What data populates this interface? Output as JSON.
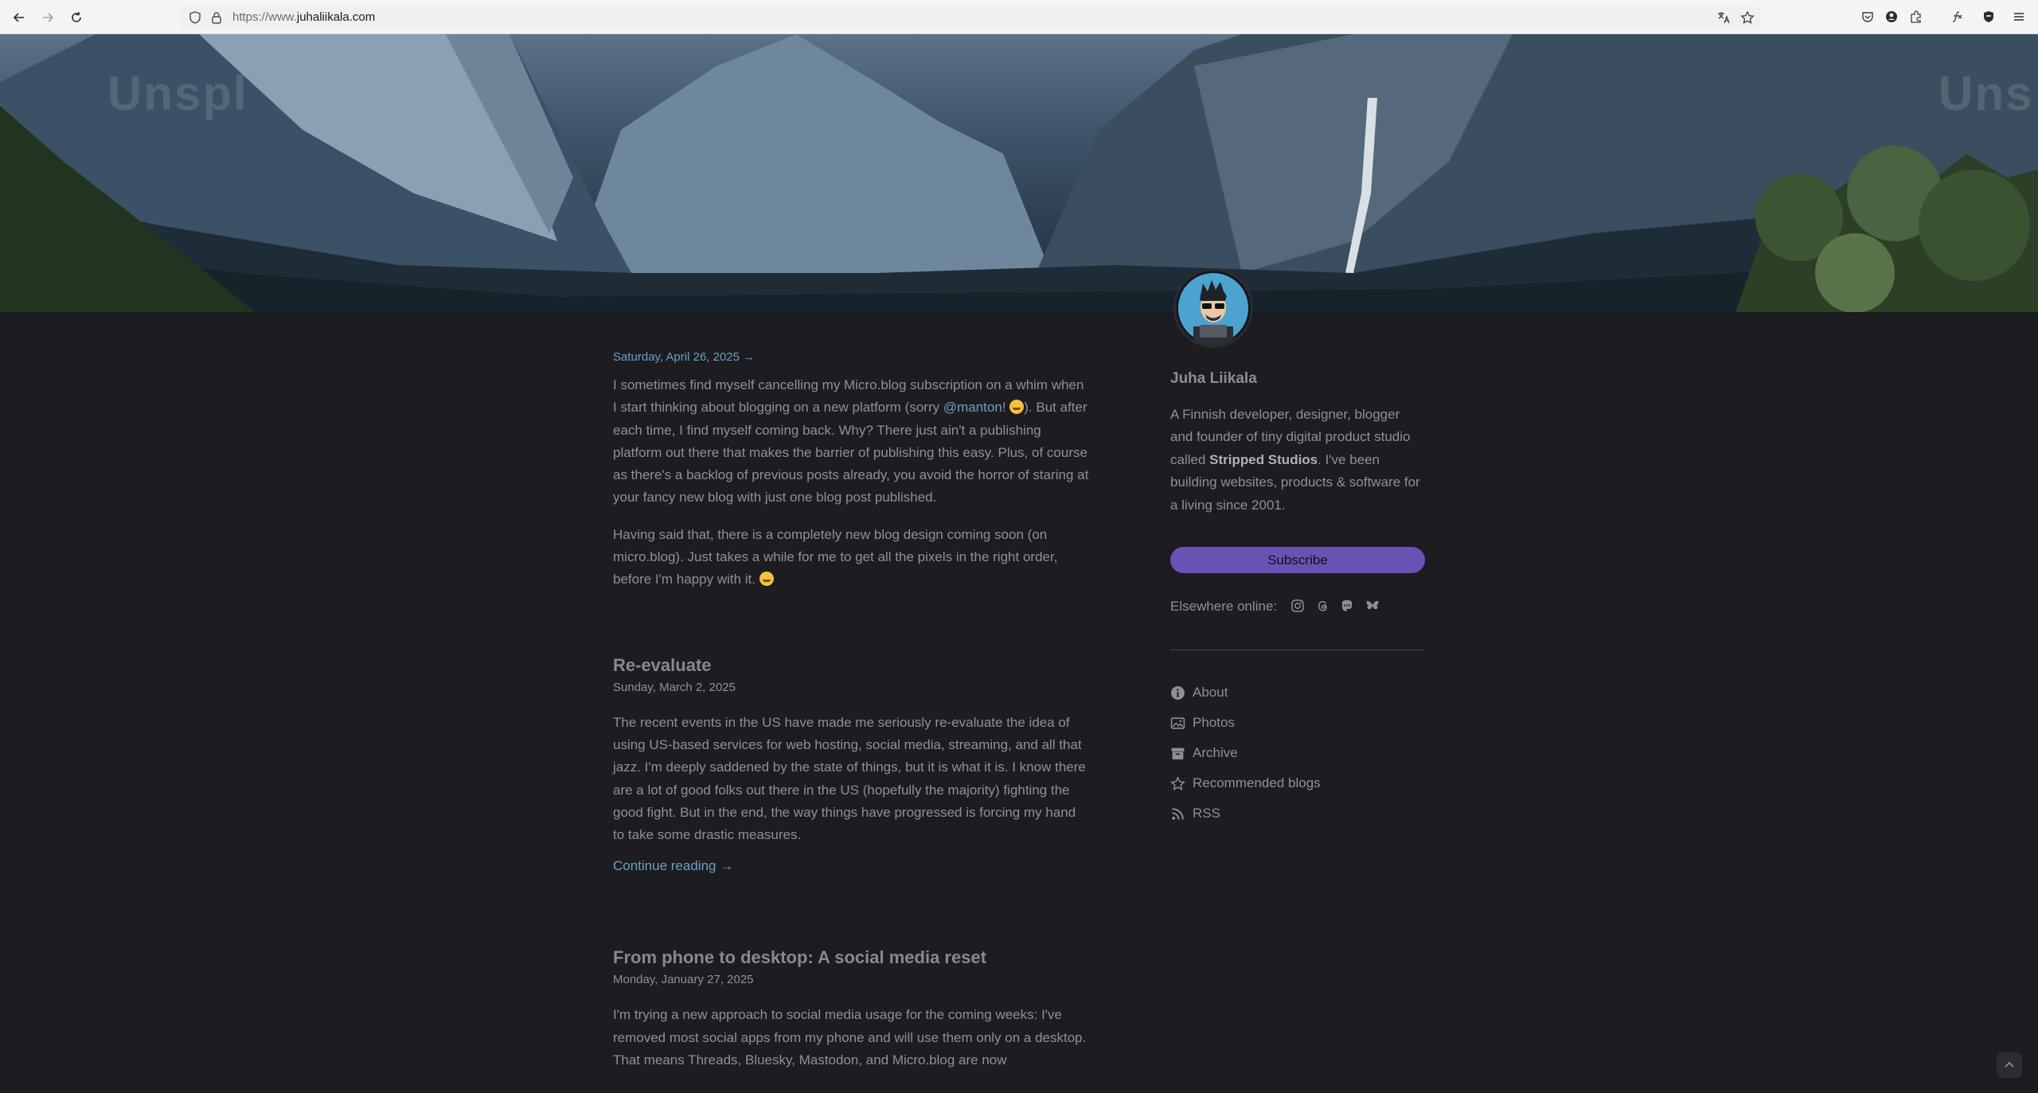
{
  "browser": {
    "url_prefix": "https://www.",
    "url_domain": "juhaliikala.com"
  },
  "hero": {
    "watermark_left": "Unspl",
    "watermark_right": "Uns"
  },
  "posts": [
    {
      "date": "Saturday, April 26, 2025 →",
      "paragraphs": [
        {
          "before_link": "I sometimes find myself cancelling my Micro.blog subscription on a whim when I start thinking about blogging on a new platform (sorry ",
          "link": "@manton",
          "after_link": "! ",
          "after_emoji": "). But after each time, I find myself coming back. Why? There just ain't a publishing platform out there that makes the barrier of publishing this easy. Plus, of course as there's a backlog of previous posts already, you avoid the horror of staring at your fancy new blog with just one blog post published."
        },
        {
          "text": "Having said that, there is a completely new blog design coming soon (on micro.blog). Just takes a while for me to get all the pixels in the right order, before I'm happy with it. "
        }
      ]
    },
    {
      "title": "Re-evaluate",
      "date": "Sunday, March 2, 2025",
      "paragraph": "The recent events in the US have made me seriously re-evaluate the idea of using US-based services for web hosting, social media, streaming, and all that jazz. I'm deeply saddened by the state of things, but it is what it is. I know there are a lot of good folks out there in the US (hopefully the majority) fighting the good fight. But in the end, the way things have progressed is forcing my hand to take some drastic measures.",
      "continue": "Continue reading →"
    },
    {
      "title": "From phone to desktop: A social media reset",
      "date": "Monday, January 27, 2025",
      "paragraph": "I'm trying a new approach to social media usage for the coming weeks: I've removed most social apps from my phone and will use them only on a desktop. That means Threads, Bluesky, Mastodon, and Micro.blog are now"
    }
  ],
  "sidebar": {
    "name": "Juha Liikala",
    "bio_before": "A Finnish developer, designer, blogger and founder of tiny digital product studio called ",
    "bio_bold": "Stripped Studios",
    "bio_after": ". I've been building websites, products & software for a living since 2001.",
    "subscribe": "Subscribe",
    "elsewhere": "Elsewhere online:",
    "social_icons": [
      "instagram-icon",
      "threads-icon",
      "mastodon-icon",
      "bluesky-icon"
    ],
    "menu": [
      {
        "label": "About",
        "icon": "info-icon"
      },
      {
        "label": "Photos",
        "icon": "photo-icon"
      },
      {
        "label": "Archive",
        "icon": "archive-icon"
      },
      {
        "label": "Recommended blogs",
        "icon": "star-icon"
      },
      {
        "label": "RSS",
        "icon": "rss-icon"
      }
    ]
  },
  "colors": {
    "page_bg": "#1c1c21",
    "link": "#6e9fc0",
    "subscribe_bg": "#6853b5"
  }
}
